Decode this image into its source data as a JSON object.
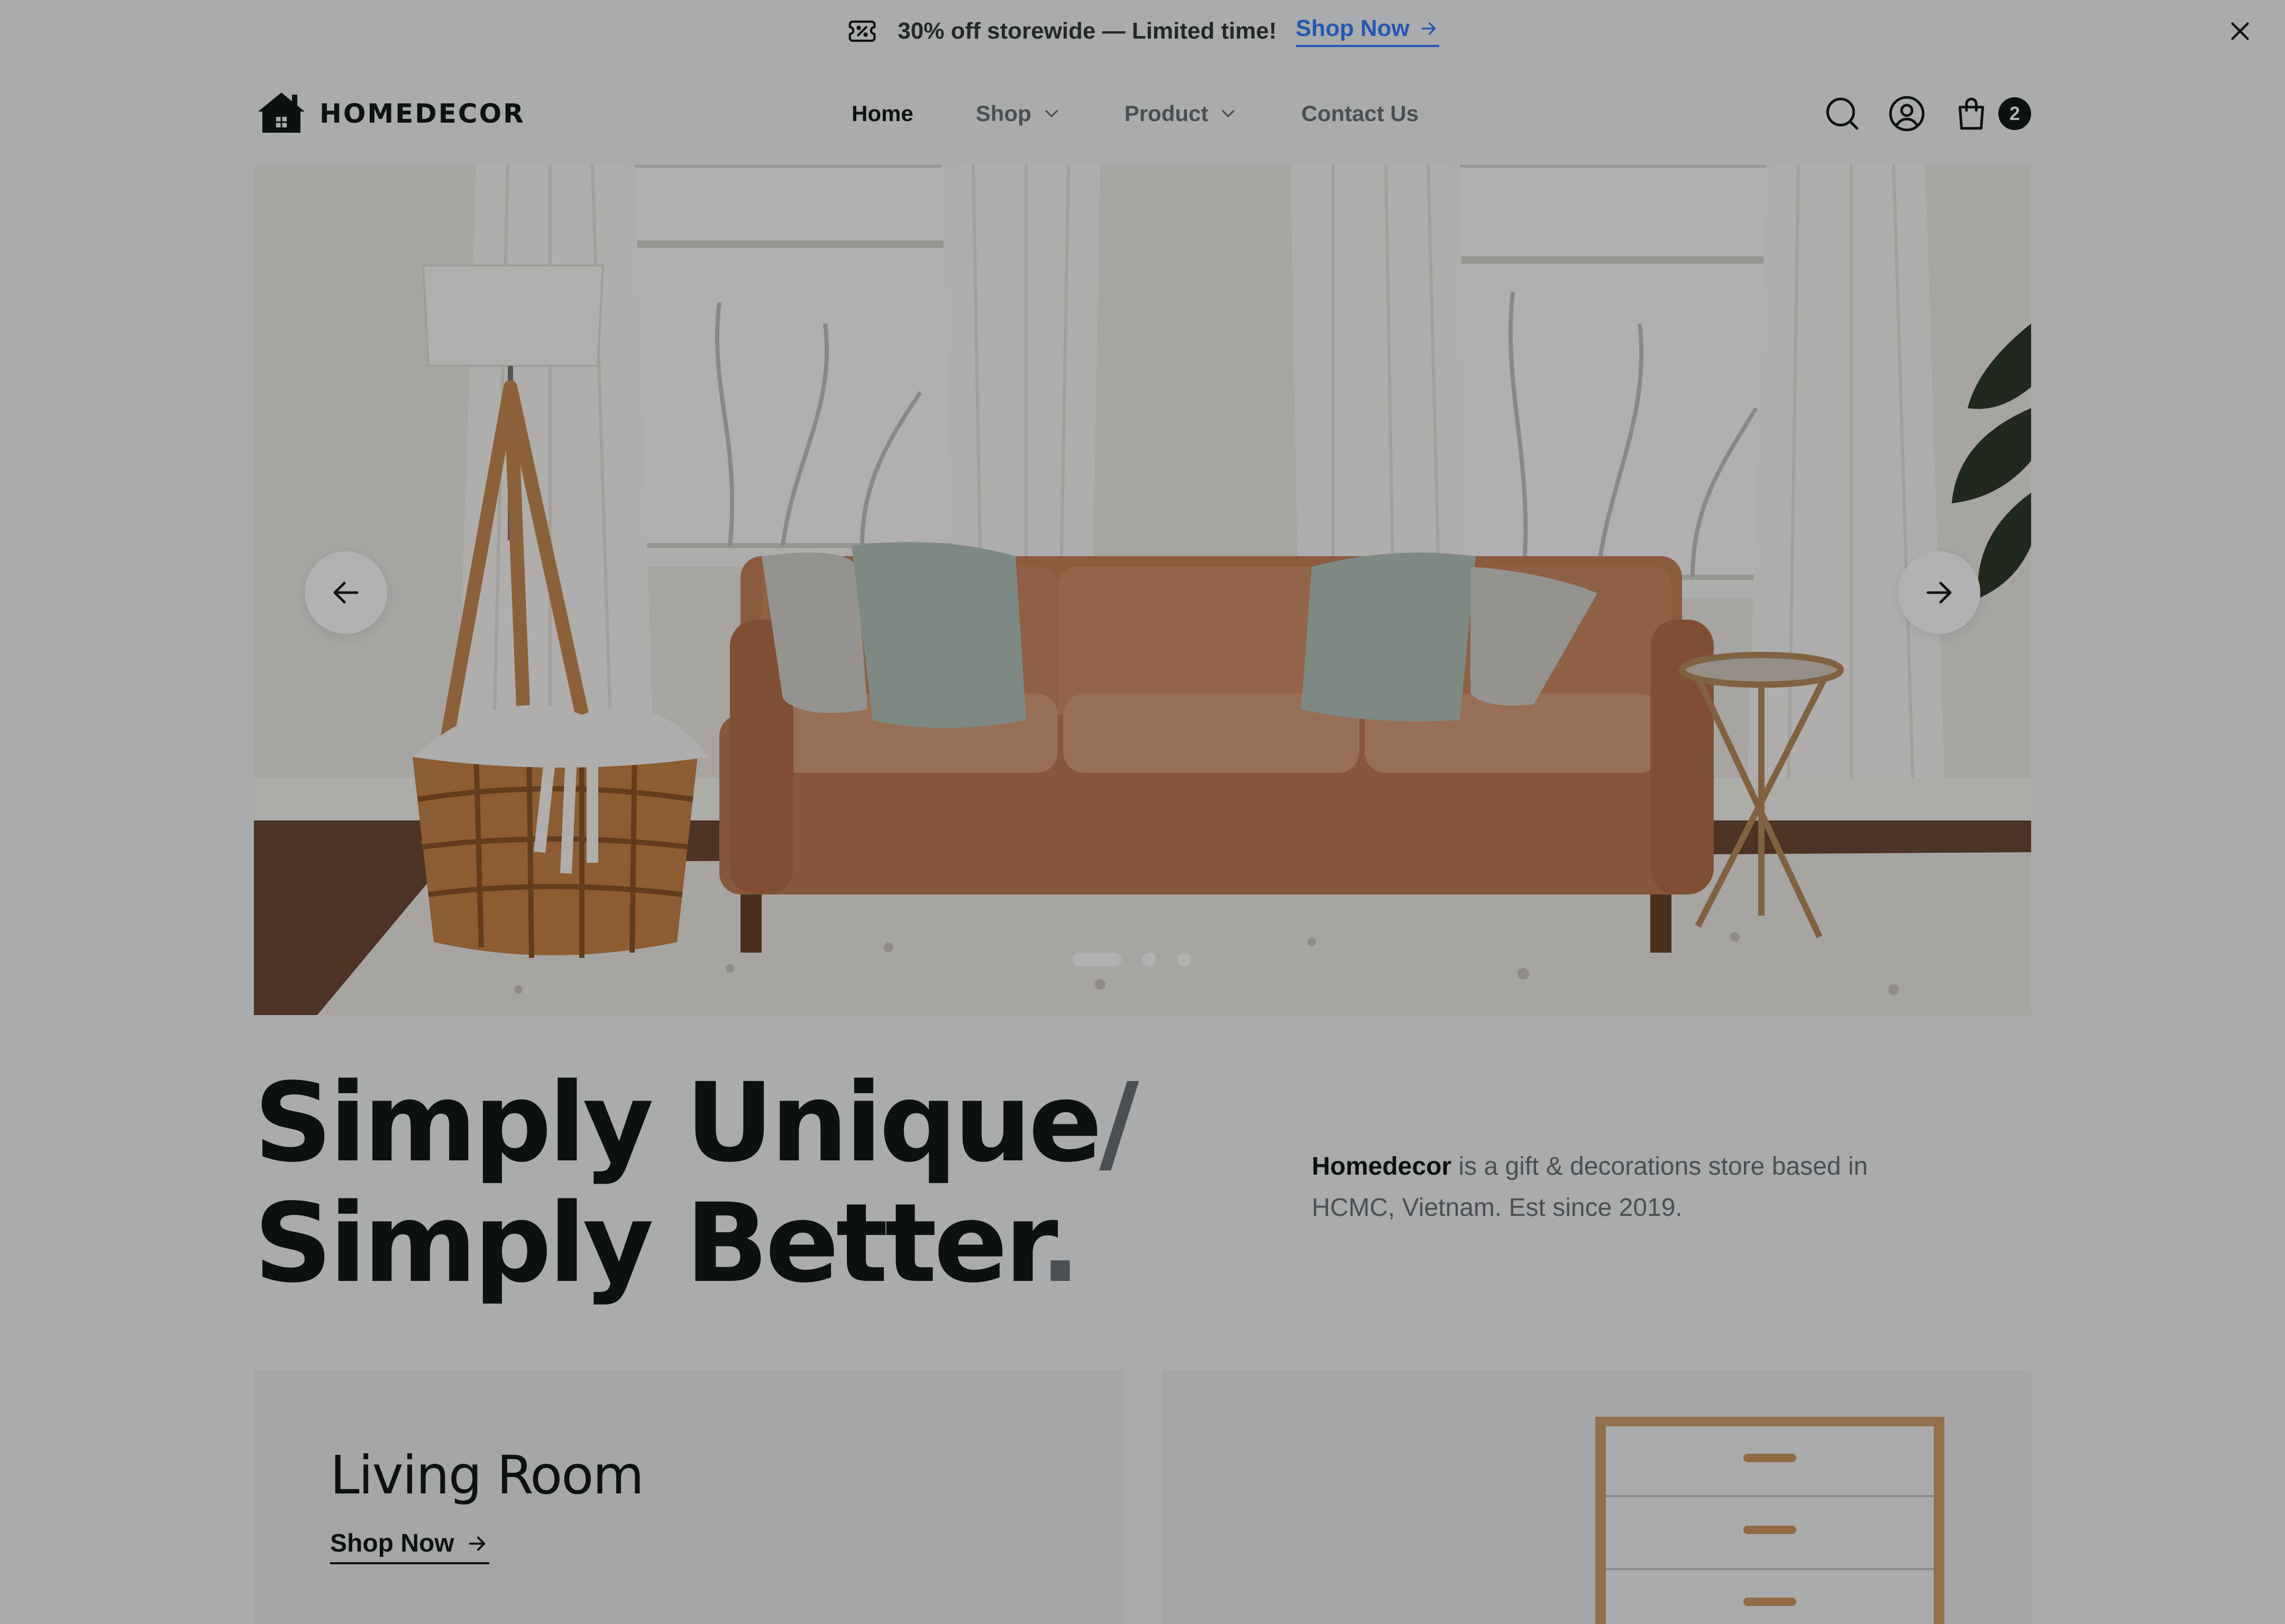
{
  "promo": {
    "text": "30% off storewide — Limited time!",
    "link_label": "Shop Now",
    "icon": "ticket-percent-icon"
  },
  "brand": {
    "name": "HOMEDECOR"
  },
  "nav": {
    "items": [
      {
        "label": "Home",
        "active": true,
        "dropdown": false
      },
      {
        "label": "Shop",
        "active": false,
        "dropdown": true
      },
      {
        "label": "Product",
        "active": false,
        "dropdown": true
      },
      {
        "label": "Contact Us",
        "active": false,
        "dropdown": false
      }
    ]
  },
  "cart": {
    "count": "2"
  },
  "hero": {
    "slide_count": 3,
    "active_slide": 1
  },
  "headline": {
    "line1": "Simply Unique",
    "slash": "/",
    "line2": "Simply Better",
    "dot": "."
  },
  "about": {
    "brand": "Homedecor",
    "text": " is a gift & decorations store based in HCMC, Vietnam. Est since 2019."
  },
  "categories": [
    {
      "title": "Living Room",
      "link_label": "Shop Now"
    },
    {
      "title": "",
      "link_label": ""
    }
  ],
  "colors": {
    "accent_link": "#377dff",
    "text_primary": "#141718",
    "text_secondary": "#6c7275",
    "background": "#f3f5f7"
  }
}
